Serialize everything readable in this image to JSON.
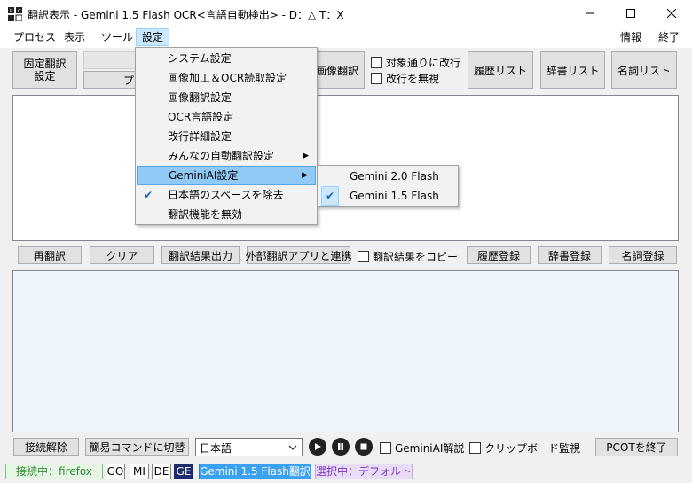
{
  "window": {
    "title": "翻訳表示 - Gemini 1.5 Flash OCR<言語自動検出> - D：△ T：X"
  },
  "menubar": {
    "process": "プロセス",
    "view": "表示",
    "tools": "ツール",
    "settings": "設定",
    "info": "情報",
    "exit": "終了"
  },
  "toolbar": {
    "fixed_translate": "固定翻訳\n設定",
    "partial_hidden": "プ",
    "image_translate": "画像翻訳",
    "linebreak_as_source": "対象通りに改行",
    "ignore_linebreak": "改行を無視",
    "history_list": "履歴リスト",
    "dictionary_list": "辞書リスト",
    "noun_list": "名詞リスト"
  },
  "settings_menu": {
    "items": [
      {
        "label": "システム設定"
      },
      {
        "label": "画像加工＆OCR読取設定"
      },
      {
        "label": "画像翻訳設定"
      },
      {
        "label": "OCR言語設定"
      },
      {
        "label": "改行詳細設定"
      },
      {
        "label": "みんなの自動翻訳設定",
        "submenu": true
      },
      {
        "label": "GeminiAI設定",
        "submenu": true,
        "highlighted": true
      },
      {
        "label": "日本語のスペースを除去",
        "checked": true
      },
      {
        "label": "翻訳機能を無効"
      }
    ]
  },
  "gemini_submenu": {
    "items": [
      {
        "label": "Gemini 2.0 Flash",
        "checked": false
      },
      {
        "label": "Gemini 1.5 Flash",
        "checked": true
      }
    ]
  },
  "middle_bar": {
    "retranslate": "再翻訳",
    "clear": "クリア",
    "export_result": "翻訳結果出力",
    "external_app": "外部翻訳アプリと連携",
    "copy_result": "翻訳結果をコピー",
    "history_register": "履歴登録",
    "dictionary_register": "辞書登録",
    "noun_register": "名詞登録"
  },
  "bottom_bar": {
    "disconnect": "接続解除",
    "simple_command": "簡易コマンドに切替",
    "language_select": "日本語",
    "gemini_explain": "GeminiAI解説",
    "clipboard_watch": "クリップボード監視",
    "exit_pcot": "PCOTを終了"
  },
  "statusbar": {
    "connected": "接続中：firefox",
    "langs": [
      "GO",
      "MI",
      "DE",
      "GE"
    ],
    "engine": "Gemini 1.5 Flash翻訳",
    "selected": "選択中：デフォルト"
  }
}
